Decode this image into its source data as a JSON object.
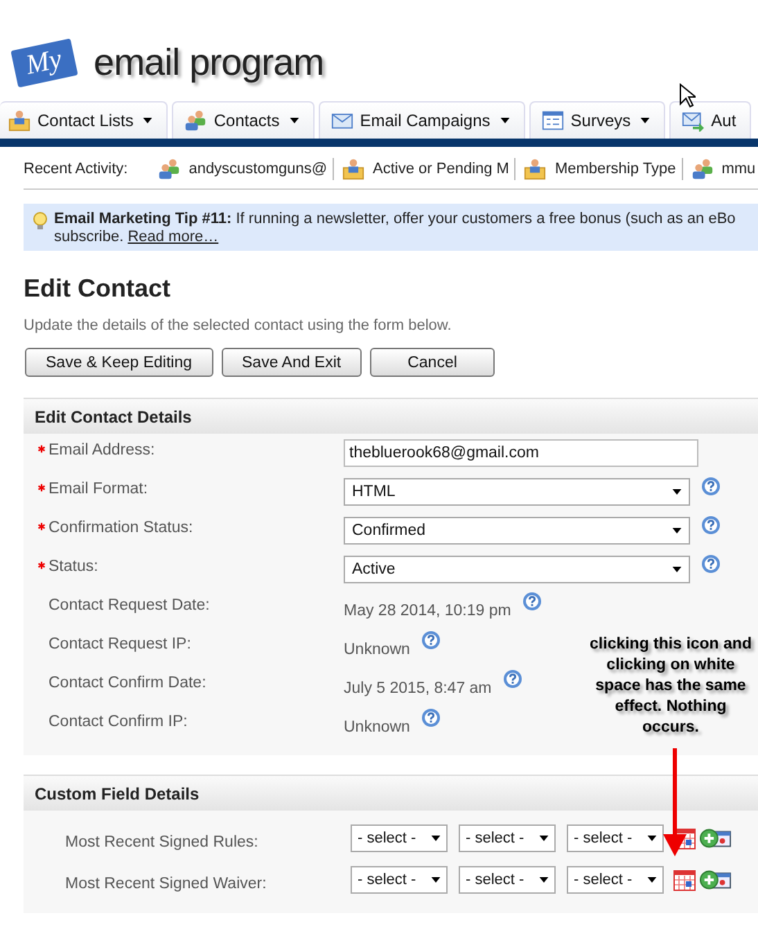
{
  "logo": {
    "badge": "My",
    "title": "email program"
  },
  "tabs": [
    {
      "label": "Contact Lists",
      "kind": "lists"
    },
    {
      "label": "Contacts",
      "kind": "contacts"
    },
    {
      "label": "Email Campaigns",
      "kind": "campaigns"
    },
    {
      "label": "Surveys",
      "kind": "surveys"
    },
    {
      "label": "Aut",
      "kind": "autoresponders"
    }
  ],
  "recent_activity": {
    "label": "Recent Activity:",
    "items": [
      {
        "text": "andyscustomguns@",
        "kind": "contacts"
      },
      {
        "text": "Active or Pending M",
        "kind": "lists"
      },
      {
        "text": "Membership Type",
        "kind": "lists"
      },
      {
        "text": "mmu",
        "kind": "contacts"
      }
    ]
  },
  "tip": {
    "title": "Email Marketing Tip #11:",
    "text": "If running a newsletter, offer your customers a free bonus (such as an eBo",
    "continuation": "subscribe.",
    "link": "Read more…"
  },
  "heading": "Edit Contact",
  "description": "Update the details of the selected contact using the form below.",
  "buttons": [
    "Save & Keep Editing",
    "Save And Exit",
    "Cancel"
  ],
  "sections": [
    {
      "title": "Edit Contact Details",
      "fields": [
        {
          "kind": "text",
          "label": "Email Address:",
          "required": true,
          "value": "thebluerook68@gmail.com",
          "help": false
        },
        {
          "kind": "select",
          "label": "Email Format:",
          "required": true,
          "value": "HTML",
          "help": true
        },
        {
          "kind": "select",
          "label": "Confirmation Status:",
          "required": true,
          "value": "Confirmed",
          "help": true
        },
        {
          "kind": "select",
          "label": "Status:",
          "required": true,
          "value": "Active",
          "help": true
        },
        {
          "kind": "static",
          "label": "Contact Request Date:",
          "required": false,
          "value": "May 28 2014, 10:19 pm",
          "help": true
        },
        {
          "kind": "static",
          "label": "Contact Request IP:",
          "required": false,
          "value": "Unknown",
          "help": true
        },
        {
          "kind": "static",
          "label": "Contact Confirm Date:",
          "required": false,
          "value": "July 5 2015, 8:47 am",
          "help": true
        },
        {
          "kind": "static",
          "label": "Contact Confirm IP:",
          "required": false,
          "value": "Unknown",
          "help": true
        }
      ]
    },
    {
      "title": "Custom Field Details",
      "fields": [
        {
          "kind": "date",
          "label": "Most Recent Signed Rules:",
          "required": false,
          "selects": [
            "- select -",
            "- select -",
            "- select -"
          ],
          "help": false
        },
        {
          "kind": "date",
          "label": "Most Recent Signed Waiver:",
          "required": false,
          "selects": [
            "- select -",
            "- select -",
            "- select -"
          ],
          "help": false
        }
      ]
    }
  ],
  "annotation": {
    "text": "clicking this icon and clicking on white space has the same effect. Nothing occurs."
  }
}
